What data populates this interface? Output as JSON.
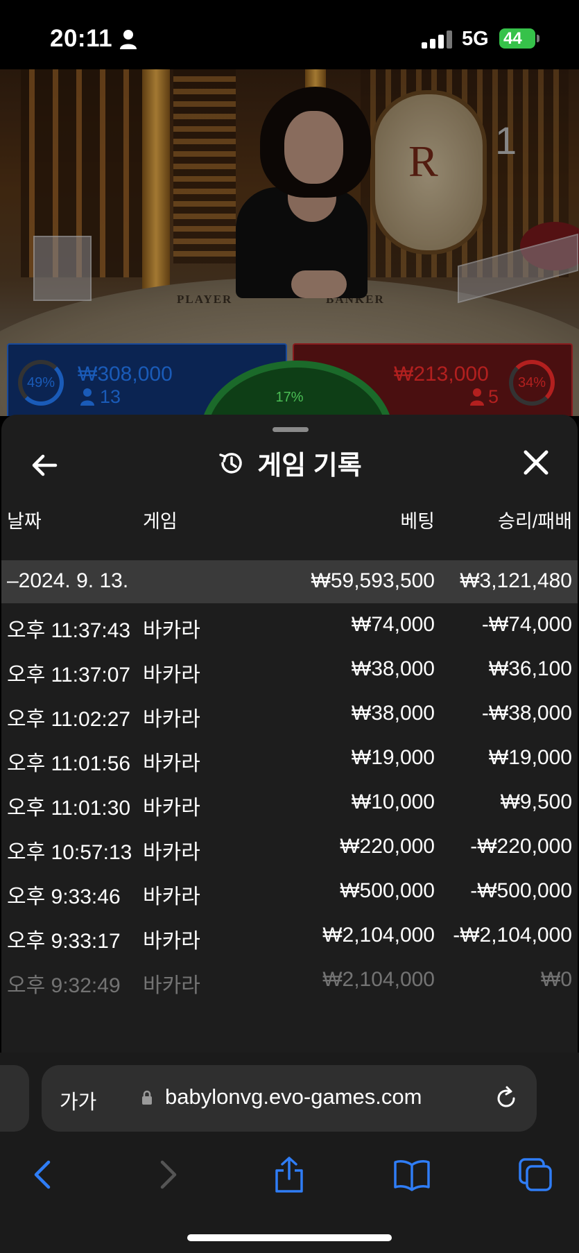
{
  "status_bar": {
    "time": "20:11",
    "network": "5G",
    "battery": "44"
  },
  "video": {
    "round_number": "1",
    "table_labels": {
      "player": "PLAYER",
      "banker": "BANKER"
    },
    "player_bet": {
      "percent": "49%",
      "amount": "₩308,000",
      "count": "13"
    },
    "banker_bet": {
      "percent": "34%",
      "amount": "₩213,000",
      "count": "5"
    },
    "tie_bet": {
      "percent": "17%"
    }
  },
  "sheet": {
    "title": "게임 기록",
    "columns": {
      "date": "날짜",
      "game": "게임",
      "bet": "베팅",
      "win_loss": "승리/패배"
    },
    "summary": {
      "date": "–2024. 9. 13.",
      "bet": "₩59,593,500",
      "win_loss": "₩3,121,480"
    },
    "rows": [
      {
        "time": "오후 11:37:43",
        "game": "바카라",
        "bet": "₩74,000",
        "win_loss": "-₩74,000"
      },
      {
        "time": "오후 11:37:07",
        "game": "바카라",
        "bet": "₩38,000",
        "win_loss": "₩36,100"
      },
      {
        "time": "오후 11:02:27",
        "game": "바카라",
        "bet": "₩38,000",
        "win_loss": "-₩38,000"
      },
      {
        "time": "오후 11:01:56",
        "game": "바카라",
        "bet": "₩19,000",
        "win_loss": "₩19,000"
      },
      {
        "time": "오후 11:01:30",
        "game": "바카라",
        "bet": "₩10,000",
        "win_loss": "₩9,500"
      },
      {
        "time": "오후 10:57:13",
        "game": "바카라",
        "bet": "₩220,000",
        "win_loss": "-₩220,000"
      },
      {
        "time": "오후 9:33:46",
        "game": "바카라",
        "bet": "₩500,000",
        "win_loss": "-₩500,000"
      },
      {
        "time": "오후 9:33:17",
        "game": "바카라",
        "bet": "₩2,104,000",
        "win_loss": "-₩2,104,000"
      },
      {
        "time": "오후 9:32:49",
        "game": "바카라",
        "bet": "₩2,104,000",
        "win_loss": "₩0"
      }
    ]
  },
  "browser": {
    "text_size_label": "가가",
    "url": "babylonvg.evo-games.com"
  },
  "colors": {
    "player_blue": "#1a5bb8",
    "banker_red": "#b3201f",
    "tie_green": "#2d9a3c",
    "ios_blue": "#2f7df6"
  }
}
